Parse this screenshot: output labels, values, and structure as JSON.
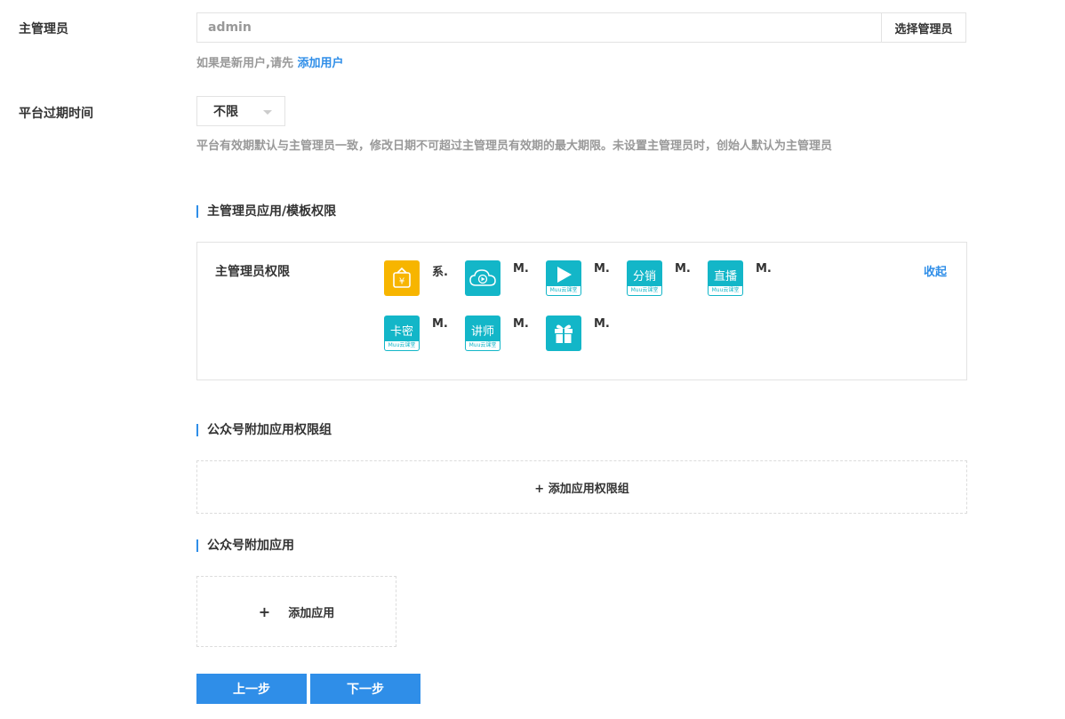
{
  "admin": {
    "label": "主管理员",
    "input_value": "admin",
    "select_button": "选择管理员",
    "hint_prefix": "如果是新用户,请先",
    "add_user_link": "添加用户"
  },
  "expiry": {
    "label": "平台过期时间",
    "selected": "不限",
    "hint": "平台有效期默认与主管理员一致，修改日期不可超过主管理员有效期的最大期限。未设置主管理员时，创始人默认为主管理员"
  },
  "admin_perms": {
    "section_title": "主管理员应用/模板权限",
    "box_label": "主管理员权限",
    "collapse": "收起",
    "apps": [
      {
        "icon": "yuan-bag-icon",
        "name": "系.",
        "color": "#f7b500"
      },
      {
        "icon": "cloud-play-icon",
        "name": "M.",
        "color": "#13b6c8"
      },
      {
        "icon": "play-icon",
        "name": "M.",
        "color": "#13b6c8",
        "band": "Muu云课堂"
      },
      {
        "icon": "distribution-icon",
        "name": "M.",
        "color": "#13b6c8",
        "text": "分销",
        "band": "Muu云课堂"
      },
      {
        "icon": "live-icon",
        "name": "M.",
        "color": "#13b6c8",
        "text": "直播",
        "band": "Muu云课堂"
      },
      {
        "icon": "card-code-icon",
        "name": "M.",
        "color": "#13b6c8",
        "text": "卡密",
        "band": "Muu云课堂"
      },
      {
        "icon": "lecturer-icon",
        "name": "M.",
        "color": "#13b6c8",
        "text": "讲师",
        "band": "Muu云课堂"
      },
      {
        "icon": "gift-icon",
        "name": "M.",
        "color": "#13b6c8"
      }
    ]
  },
  "extra_group": {
    "section_title": "公众号附加应用权限组",
    "add_label": "+ 添加应用权限组"
  },
  "extra_app": {
    "section_title": "公众号附加应用",
    "plus": "+",
    "add_label": "添加应用"
  },
  "actions": {
    "prev": "上一步",
    "next": "下一步"
  }
}
